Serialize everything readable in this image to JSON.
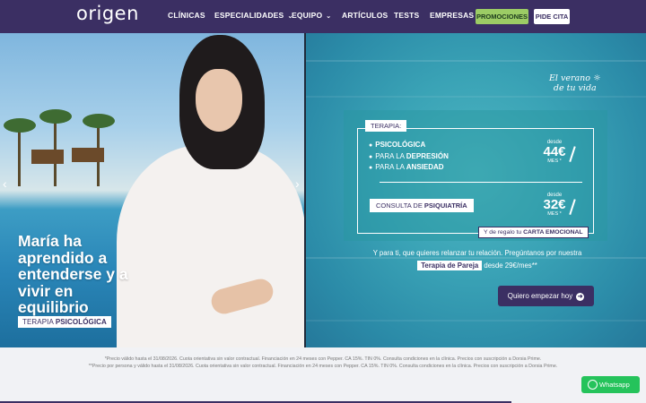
{
  "brand": {
    "logo": "origen"
  },
  "nav": {
    "items": [
      {
        "label": "CLÍNICAS",
        "dropdown": false
      },
      {
        "label": "ESPECIALIDADES",
        "dropdown": true
      },
      {
        "label": "EQUIPO",
        "dropdown": true
      },
      {
        "label": "ARTÍCULOS",
        "dropdown": false
      },
      {
        "label": "TESTS",
        "dropdown": false
      },
      {
        "label": "EMPRESAS",
        "dropdown": false
      }
    ],
    "promo_button": "PROMOCIONES",
    "cita_button": "PIDE CITA"
  },
  "hero_left": {
    "title": "María ha aprendido a entenderse y a vivir en equilibrio",
    "tag_prefix": "TERAPIA ",
    "tag_bold": "PSICOLÓGICA",
    "prev_arrow": "‹",
    "next_arrow": "›"
  },
  "hero_right": {
    "slogan_line1": "El verano",
    "slogan_line2": "de tu vida",
    "terapia_label": "TERAPIA:",
    "therapies": [
      {
        "prefix": "",
        "bold": "PSICOLÓGICA"
      },
      {
        "prefix": "PARA LA ",
        "bold": "DEPRESIÓN"
      },
      {
        "prefix": "PARA LA ",
        "bold": "ANSIEDAD"
      }
    ],
    "price1": {
      "from": "desde",
      "amount": "44€",
      "per": "MES *"
    },
    "psiquiatria_prefix": "CONSULTA DE ",
    "psiquiatria_bold": "PSIQUIATRÍA",
    "price2": {
      "from": "desde",
      "amount": "32€",
      "per": "MES *"
    },
    "gift_prefix": "Y de regalo tu ",
    "gift_bold": "CARTA EMOCIONAL",
    "pareja_line1": "Y para ti, que quieres relanzar tu relación. Pregúntanos por nuestra",
    "pareja_chip": "Terapia de Pareja",
    "pareja_suffix": " desde 29€/mes**",
    "cta_label": "Quiero empezar hoy",
    "cta_arrow": "➜"
  },
  "footer": {
    "note1": "*Precio válido hasta el 31/08/2026. Cuota orientativa sin valor contractual. Financiación en 24 meses con Pepper. CA 15%. TIN 0%. Consulta condiciones en la clínica. Precios con suscripción a Dorsia Prime.",
    "note2": "**Precio por persona y válido hasta el 31/08/2026. Cuota orientativa sin valor contractual. Financiación en 24 meses con Pepper. CA 15%. TIN 0%. Consulta condiciones en la clínica. Precios con suscripción a Dorsia Prime.",
    "whatsapp_label": "Whatsapp"
  },
  "colors": {
    "brand_purple": "#3b2f63",
    "promo_green": "#9ccc65",
    "whatsapp_green": "#25c35b"
  }
}
